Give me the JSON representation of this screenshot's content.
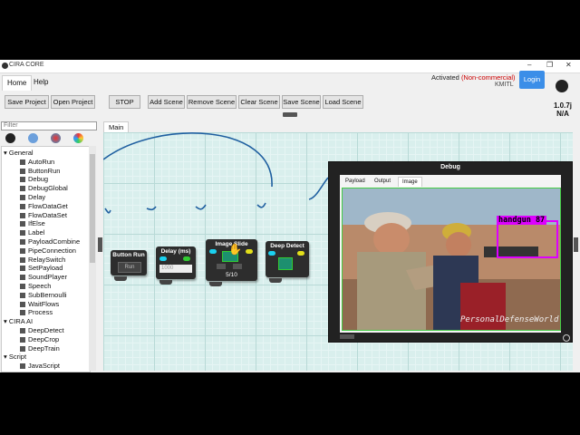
{
  "window": {
    "title": "CIRA CORE",
    "minimize": "–",
    "maximize": "❐",
    "close": "✕"
  },
  "menu": {
    "tabs": [
      "Home",
      "Help"
    ]
  },
  "license": {
    "prefix": "Activated ",
    "status": "(Non-commercial)",
    "org": "KMITL"
  },
  "login_label": "Login",
  "version": {
    "line1": "1.0.7j",
    "line2": "N/A"
  },
  "toolbar": {
    "save_project": "Save Project",
    "open_project": "Open Project",
    "stop": "STOP",
    "add_scene": "Add Scene",
    "remove_scene": "Remove Scene",
    "clear_scene": "Clear Scene",
    "save_scene": "Save Scene",
    "load_scene": "Load Scene"
  },
  "sidebar": {
    "filter_placeholder": "Filter",
    "tree": [
      {
        "type": "cat",
        "label": "General"
      },
      {
        "type": "item",
        "label": "AutoRun"
      },
      {
        "type": "item",
        "label": "ButtonRun"
      },
      {
        "type": "item",
        "label": "Debug"
      },
      {
        "type": "item",
        "label": "DebugGlobal"
      },
      {
        "type": "item",
        "label": "Delay"
      },
      {
        "type": "item",
        "label": "FlowDataGet"
      },
      {
        "type": "item",
        "label": "FlowDataSet"
      },
      {
        "type": "item",
        "label": "IfElse"
      },
      {
        "type": "item",
        "label": "Label"
      },
      {
        "type": "item",
        "label": "PayloadCombine"
      },
      {
        "type": "item",
        "label": "PipeConnection"
      },
      {
        "type": "item",
        "label": "RelaySwitch"
      },
      {
        "type": "item",
        "label": "SetPayload"
      },
      {
        "type": "item",
        "label": "SoundPlayer"
      },
      {
        "type": "item",
        "label": "Speech"
      },
      {
        "type": "item",
        "label": "SubBernoulli"
      },
      {
        "type": "item",
        "label": "WaitFlows"
      },
      {
        "type": "item",
        "label": "Process"
      },
      {
        "type": "cat",
        "label": "CIRA AI"
      },
      {
        "type": "item",
        "label": "DeepDetect"
      },
      {
        "type": "item",
        "label": "DeepCrop"
      },
      {
        "type": "item",
        "label": "DeepTrain"
      },
      {
        "type": "cat",
        "label": "Script"
      },
      {
        "type": "item",
        "label": "JavaScript"
      }
    ]
  },
  "main_tab": "Main",
  "nodes": {
    "button_run": {
      "title": "Button Run",
      "button": "Run"
    },
    "delay": {
      "title": "Delay (ms)",
      "value": "1000"
    },
    "image_slide": {
      "title": "Image Slide",
      "counter": "5/10"
    },
    "deep_detect": {
      "title": "Deep Detect"
    }
  },
  "debug_panel": {
    "title": "Debug",
    "tabs": [
      "Payload",
      "Output",
      "Image"
    ],
    "detection_label": "handgun 87",
    "watermark": "PersonalDefenseWorld"
  },
  "colors": {
    "accent": "#3b8ee8",
    "noncommercial": "#cc0000",
    "bbox": "#dd00ff",
    "port_in": "#1bd1f0",
    "port_out": "#e3df1a"
  }
}
